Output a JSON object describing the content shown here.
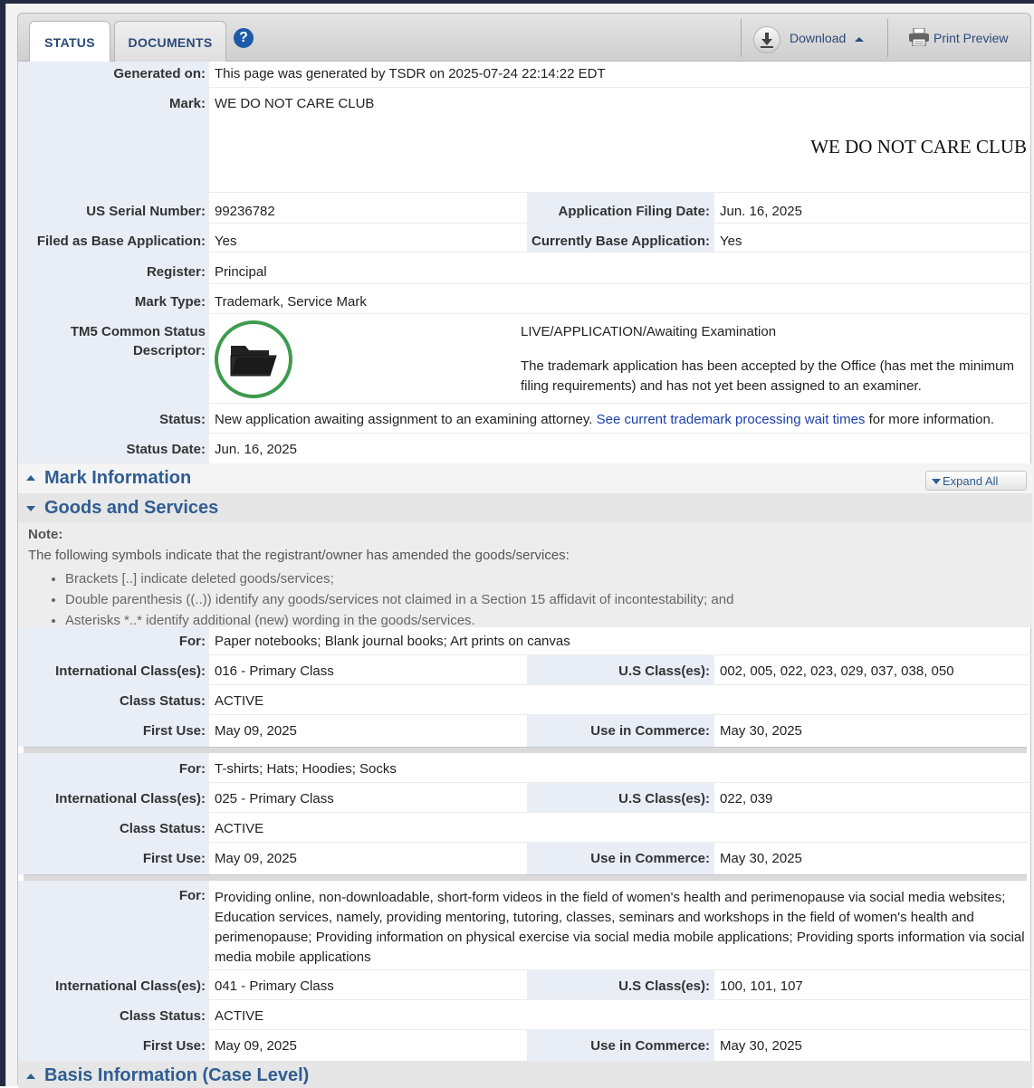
{
  "tabs": [
    {
      "label": "STATUS"
    },
    {
      "label": "DOCUMENTS"
    }
  ],
  "toolbar": {
    "help": "?",
    "download": "Download",
    "print_preview": "Print Preview"
  },
  "header": {
    "generated_label": "Generated on:",
    "generated_value": "This page was generated by TSDR on 2025-07-24 22:14:22 EDT",
    "mark_label": "Mark:",
    "mark_value": "WE DO NOT CARE CLUB",
    "mark_image_text": "WE DO NOT CARE CLUB",
    "serial_label": "US Serial Number:",
    "serial_value": "99236782",
    "filing_label": "Application Filing Date:",
    "filing_value": "Jun. 16, 2025",
    "filed_base_label": "Filed as Base Application:",
    "filed_base_value": "Yes",
    "current_base_label": "Currently Base Application:",
    "current_base_value": "Yes",
    "register_label": "Register:",
    "register_value": "Principal",
    "mark_type_label": "Mark Type:",
    "mark_type_value": "Trademark, Service Mark",
    "tm5_label_1": "TM5 Common Status",
    "tm5_label_2": "Descriptor:",
    "tm5_status": "LIVE/APPLICATION/Awaiting Examination",
    "tm5_description": "The trademark application has been accepted by the Office (has met the minimum filing requirements) and has not yet been assigned to an examiner.",
    "status_label": "Status:",
    "status_text_before": "New application awaiting assignment to an examining attorney.",
    "status_link": "See current trademark processing wait times",
    "status_text_after": "for more information.",
    "status_date_label": "Status Date:",
    "status_date_value": "Jun. 16, 2025"
  },
  "sections": {
    "mark_information": "Mark Information",
    "expand_all": "Expand All",
    "goods_and_services": "Goods and Services",
    "basis_information": "Basis Information (Case Level)"
  },
  "note": {
    "title": "Note:",
    "intro": "The following symbols indicate that the registrant/owner has amended the goods/services:",
    "items": [
      "Brackets [..] indicate deleted goods/services;",
      "Double parenthesis ((..)) identify any goods/services not claimed in a Section 15 affidavit of incontestability; and",
      "Asterisks *..* identify additional (new) wording in the goods/services."
    ]
  },
  "labels": {
    "for": "For:",
    "intl_class": "International Class(es):",
    "us_class": "U.S Class(es):",
    "class_status": "Class Status:",
    "first_use": "First Use:",
    "use_in_commerce": "Use in Commerce:"
  },
  "goods": [
    {
      "for": "Paper notebooks; Blank journal books; Art prints on canvas",
      "intl_class": "016 - Primary Class",
      "us_class": "002, 005, 022, 023, 029, 037, 038, 050",
      "class_status": "ACTIVE",
      "first_use": "May 09, 2025",
      "use_in_commerce": "May 30, 2025"
    },
    {
      "for": "T-shirts; Hats; Hoodies; Socks",
      "intl_class": "025 - Primary Class",
      "us_class": "022, 039",
      "class_status": "ACTIVE",
      "first_use": "May 09, 2025",
      "use_in_commerce": "May 30, 2025"
    },
    {
      "for": "Providing online, non-downloadable, short-form videos in the field of women's health and perimenopause via social media websites; Education services, namely, providing mentoring, tutoring, classes, seminars and workshops in the field of women's health and perimenopause; Providing information on physical exercise via social media mobile applications; Providing sports information via social media mobile applications",
      "intl_class": "041 - Primary Class",
      "us_class": "100, 101, 107",
      "class_status": "ACTIVE",
      "first_use": "May 09, 2025",
      "use_in_commerce": "May 30, 2025"
    }
  ],
  "colors": {
    "label_bg": "#e9edf6",
    "section_title": "#2f5d92",
    "link": "#1b3fa8",
    "tm5_ring": "#3e9b4e"
  }
}
